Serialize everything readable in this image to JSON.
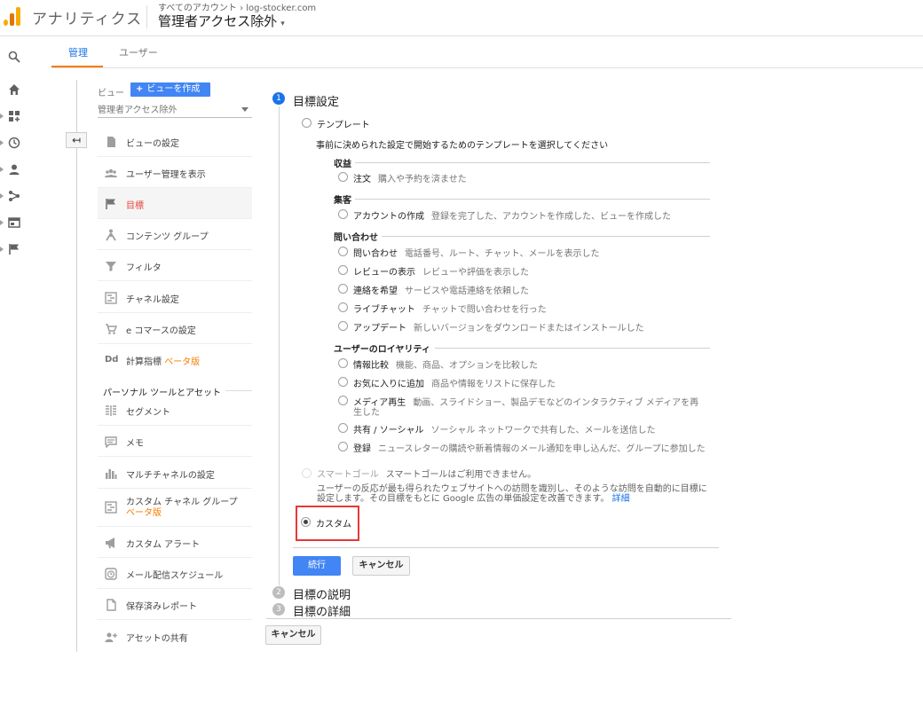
{
  "header": {
    "app_title": "アナリティクス",
    "breadcrumb": "すべてのアカウント › log-stocker.com",
    "view_name": "管理者アクセス除外",
    "caret": "▾"
  },
  "tabs": [
    {
      "label": "管理"
    },
    {
      "label": "ユーザー"
    }
  ],
  "view_column": {
    "label": "ビュー",
    "create_button": "ビューを作成",
    "plus": "+",
    "selected_view": "管理者アクセス除外",
    "back_icon": "↤",
    "items": [
      {
        "label": "ビューの設定",
        "icon": "document-icon"
      },
      {
        "label": "ユーザー管理を表示",
        "icon": "users-icon"
      },
      {
        "label": "目標",
        "icon": "flag-icon"
      },
      {
        "label": "コンテンツ グループ",
        "icon": "content-group-icon"
      },
      {
        "label": "フィルタ",
        "icon": "filter-icon"
      },
      {
        "label": "チャネル設定",
        "icon": "channel-icon"
      },
      {
        "label": "e コマースの設定",
        "icon": "cart-icon"
      },
      {
        "label": "計算指標",
        "beta": "ベータ版",
        "icon": "dd-icon"
      }
    ],
    "personal_section_title": "パーソナル ツールとアセット",
    "personal_items": [
      {
        "label": "セグメント",
        "icon": "segment-icon"
      },
      {
        "label": "メモ",
        "icon": "note-icon"
      },
      {
        "label": "マルチチャネルの設定",
        "icon": "bar-chart-icon"
      },
      {
        "label": "カスタム チャネル グループ",
        "beta": "ベータ版",
        "icon": "custom-channel-icon"
      },
      {
        "label": "カスタム アラート",
        "icon": "megaphone-icon"
      },
      {
        "label": "メール配信スケジュール",
        "icon": "clock-icon"
      },
      {
        "label": "保存済みレポート",
        "icon": "saved-report-icon"
      },
      {
        "label": "アセットの共有",
        "icon": "add-user-icon"
      }
    ]
  },
  "goal_setup": {
    "step1": {
      "number": "1",
      "title": "目標設定"
    },
    "template_label": "テンプレート",
    "template_desc": "事前に決められた設定で開始するためのテンプレートを選択してください",
    "groups": [
      {
        "title": "収益",
        "options": [
          {
            "name": "注文",
            "desc": "購入や予約を済ませた"
          }
        ]
      },
      {
        "title": "集客",
        "options": [
          {
            "name": "アカウントの作成",
            "desc": "登録を完了した、アカウントを作成した、ビューを作成した"
          }
        ]
      },
      {
        "title": "問い合わせ",
        "options": [
          {
            "name": "問い合わせ",
            "desc": "電話番号、ルート、チャット、メールを表示した"
          },
          {
            "name": "レビューの表示",
            "desc": "レビューや評価を表示した"
          },
          {
            "name": "連絡を希望",
            "desc": "サービスや電話連絡を依頼した"
          },
          {
            "name": "ライブチャット",
            "desc": "チャットで問い合わせを行った"
          },
          {
            "name": "アップデート",
            "desc": "新しいバージョンをダウンロードまたはインストールした"
          }
        ]
      },
      {
        "title": "ユーザーのロイヤリティ",
        "options": [
          {
            "name": "情報比較",
            "desc": "機能、商品、オプションを比較した"
          },
          {
            "name": "お気に入りに追加",
            "desc": "商品や情報をリストに保存した"
          },
          {
            "name": "メディア再生",
            "desc": "動画、スライドショー、製品デモなどのインタラクティブ メディアを再",
            "desc2": "生した"
          },
          {
            "name": "共有 / ソーシャル",
            "desc": "ソーシャル ネットワークで共有した、メールを送信した"
          },
          {
            "name": "登録",
            "desc": "ニュースレターの購読や新着情報のメール通知を申し込んだ、グループに参加した"
          }
        ]
      }
    ],
    "smart_goal_label": "スマートゴール",
    "smart_goal_status": "スマートゴールはご利用できません。",
    "smart_goal_desc1": "ユーザーの反応が最も得られたウェブサイトへの訪問を識別し、そのような訪問を自動的に目標に",
    "smart_goal_desc2": "設定します。その目標をもとに Google 広告の単価設定を改善できます。",
    "smart_goal_link": "詳細",
    "custom_label": "カスタム",
    "continue_button": "続行",
    "cancel_button": "キャンセル",
    "step2": {
      "number": "2",
      "title": "目標の説明"
    },
    "step3": {
      "number": "3",
      "title": "目標の詳細"
    },
    "bottom_cancel": "キャンセル"
  },
  "colors": {
    "accent_blue": "#4285f4",
    "active_tab": "#1a73e8",
    "tab_underline": "#f57c00",
    "active_nav": "#e8453c",
    "highlight_box": "#e53935"
  }
}
